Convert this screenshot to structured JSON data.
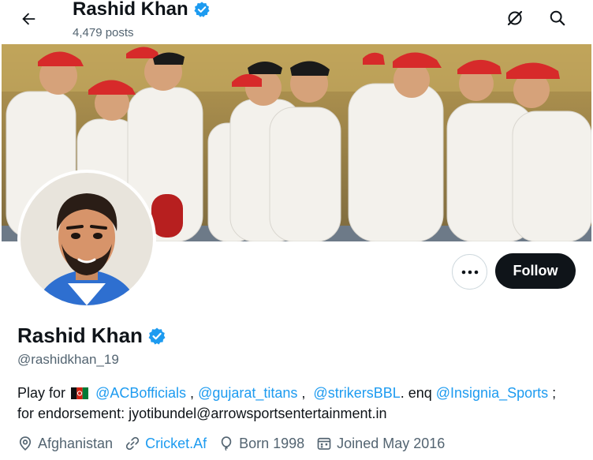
{
  "header": {
    "name": "Rashid Khan",
    "posts": "4,479 posts"
  },
  "profile": {
    "name": "Rashid Khan",
    "handle": "@rashidkhan_19",
    "follow_label": "Follow"
  },
  "bio": {
    "prefix": "Play for",
    "mention_acb": "@ACBofficials",
    "sep1": " , ",
    "mention_gt": "@gujarat_titans",
    "sep2": " ,  ",
    "mention_strikers": "@strikersBBL",
    "mid": ". enq ",
    "mention_insignia": "@Insignia_Sports",
    "suffix": " ;",
    "line2": "for endorsement: jyotibundel@arrowsportsentertainment.in"
  },
  "meta": {
    "location": "Afghanistan",
    "website": "Cricket.Af",
    "born": "Born 1998",
    "joined": "Joined May 2016"
  },
  "colors": {
    "accent": "#1d9bf0",
    "text": "#0f1419",
    "muted": "#536471",
    "follow_bg": "#0f1419",
    "verified": "#1d9bf0"
  },
  "icons": {
    "back": "arrow-left-icon",
    "grok": "grok-icon",
    "search": "search-icon",
    "verified": "verified-badge-icon",
    "more": "more-dots-icon",
    "location": "location-pin-icon",
    "link": "link-icon",
    "born": "balloon-icon",
    "calendar": "calendar-icon"
  }
}
